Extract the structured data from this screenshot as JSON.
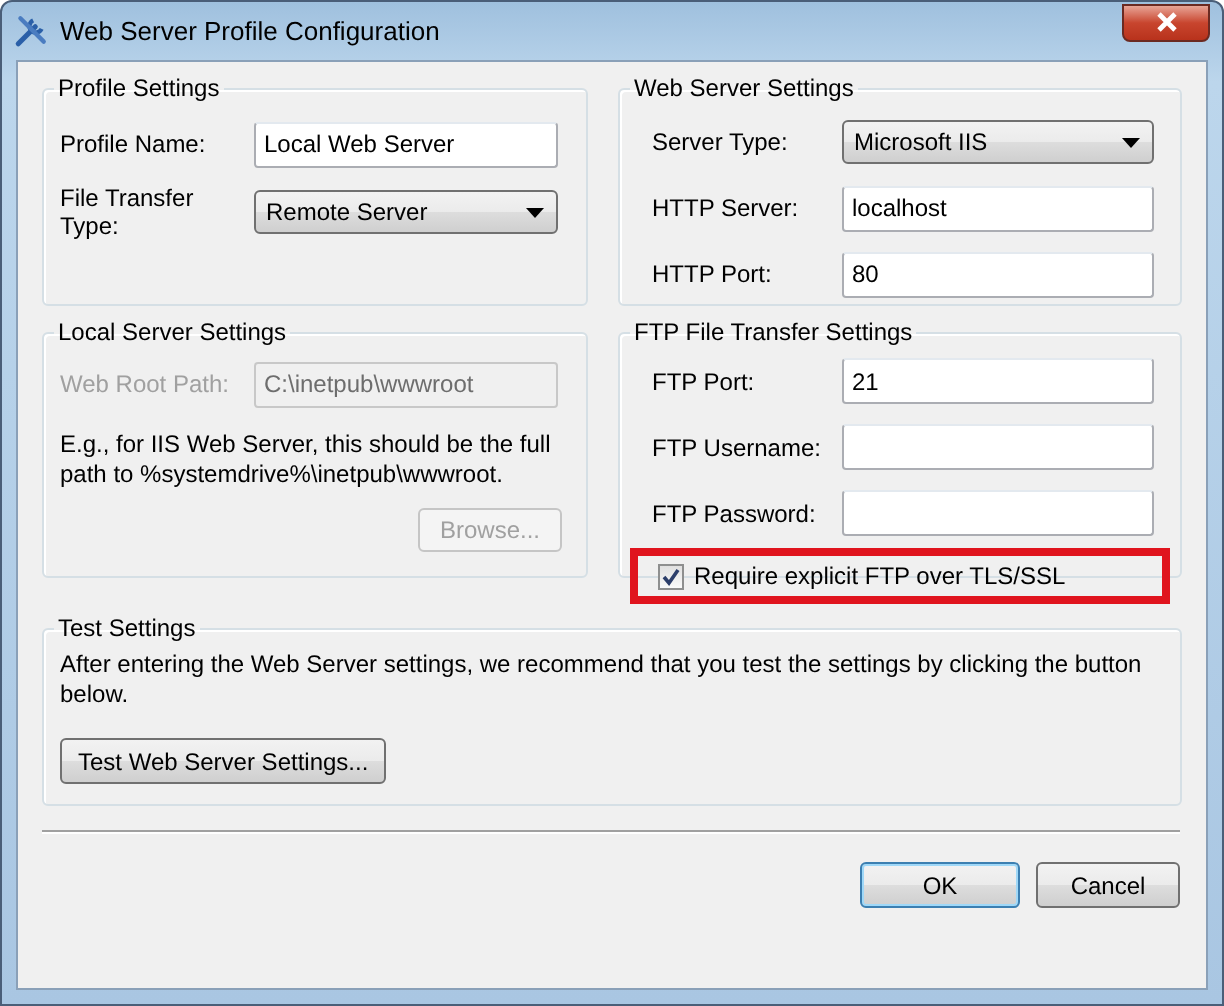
{
  "window": {
    "title": "Web Server Profile Configuration"
  },
  "profile_settings": {
    "title": "Profile Settings",
    "fields": [
      {
        "label": "Profile Name:",
        "kind": "text",
        "value": "Local Web Server",
        "disabled": false
      },
      {
        "label": "File Transfer Type:",
        "kind": "dropdown",
        "value": "Remote Server",
        "disabled": false
      }
    ]
  },
  "web_server_settings": {
    "title": "Web Server Settings",
    "fields": [
      {
        "label": "Server Type:",
        "kind": "dropdown",
        "value": "Microsoft IIS",
        "disabled": false
      },
      {
        "label": "HTTP Server:",
        "kind": "text",
        "value": "localhost",
        "disabled": false
      },
      {
        "label": "HTTP Port:",
        "kind": "text",
        "value": "80",
        "disabled": false
      }
    ]
  },
  "local_server_settings": {
    "title": "Local Server Settings",
    "fields": [
      {
        "label": "Web Root Path:",
        "kind": "text",
        "value": "C:\\inetpub\\wwwroot",
        "disabled": true
      }
    ],
    "note": "E.g., for IIS Web Server, this should be the full path to %systemdrive%\\inetpub\\wwwroot.",
    "browse_button": {
      "label": "Browse...",
      "disabled": true
    }
  },
  "ftp_settings": {
    "title": "FTP File Transfer Settings",
    "fields": [
      {
        "label": "FTP Port:",
        "kind": "text",
        "value": "21",
        "disabled": false
      },
      {
        "label": "FTP Username:",
        "kind": "text",
        "disabled": false
      },
      {
        "label": "FTP Password:",
        "kind": "text",
        "disabled": false
      }
    ],
    "checkbox": {
      "label": "Require explicit FTP over TLS/SSL",
      "checked": true,
      "highlighted": true
    }
  },
  "test_settings": {
    "title": "Test Settings",
    "note": "After entering the Web Server settings, we recommend that you test the settings by clicking the button below.",
    "button": {
      "label": "Test Web Server Settings..."
    }
  },
  "buttons": [
    {
      "label": "OK",
      "default": true
    },
    {
      "label": "Cancel",
      "default": false
    }
  ]
}
